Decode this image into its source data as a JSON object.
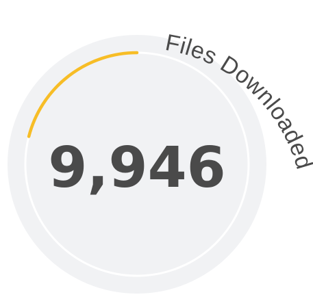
{
  "widget": {
    "label": "Files Downloaded",
    "value_display": "9,946",
    "progress_fraction": 0.21
  },
  "colors": {
    "track": "#f1f2f4",
    "ring": "#ffffff",
    "progress": "#f7bd26",
    "text": "#4a4a4a"
  }
}
